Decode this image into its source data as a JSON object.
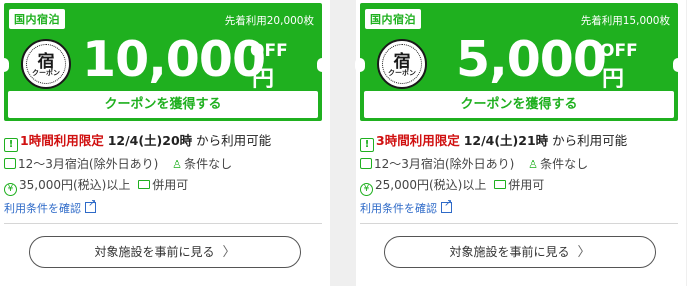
{
  "coupons": [
    {
      "tag": "国内宿泊",
      "limit": "先着利用20,000枚",
      "stamp_kanji": "宿",
      "stamp_sub": "クーポン",
      "amount": "10,000",
      "off": "OFF",
      "yen": "円",
      "acquire_label": "クーポンを獲得する",
      "time_limit": "1時間利用限定",
      "available_from": "12/4(土)20時",
      "available_suffix": "から利用可能",
      "stay_period": "12～3月宿泊(除外日あり)",
      "condition": "条件なし",
      "min_amount": "35,000円(税込)以上",
      "combine": "併用可",
      "terms_link": "利用条件を確認",
      "preview_label": "対象施設を事前に見る"
    },
    {
      "tag": "国内宿泊",
      "limit": "先着利用15,000枚",
      "stamp_kanji": "宿",
      "stamp_sub": "クーポン",
      "amount": "5,000",
      "off": "OFF",
      "yen": "円",
      "acquire_label": "クーポンを獲得する",
      "time_limit": "3時間利用限定",
      "available_from": "12/4(土)21時",
      "available_suffix": "から利用可能",
      "stay_period": "12～3月宿泊(除外日あり)",
      "condition": "条件なし",
      "min_amount": "25,000円(税込)以上",
      "combine": "併用可",
      "terms_link": "利用条件を確認",
      "preview_label": "対象施設を事前に見る"
    }
  ],
  "icons": {
    "warning": "exclamation-icon",
    "calendar": "calendar-icon",
    "person": "person-icon",
    "yen": "yen-icon",
    "card": "card-icon",
    "external": "external-link-icon",
    "chevron": "chevron-right-icon"
  },
  "colors": {
    "brand_green": "#1fb01f",
    "limit_red": "#d01010",
    "link_blue": "#2e6ac8"
  }
}
